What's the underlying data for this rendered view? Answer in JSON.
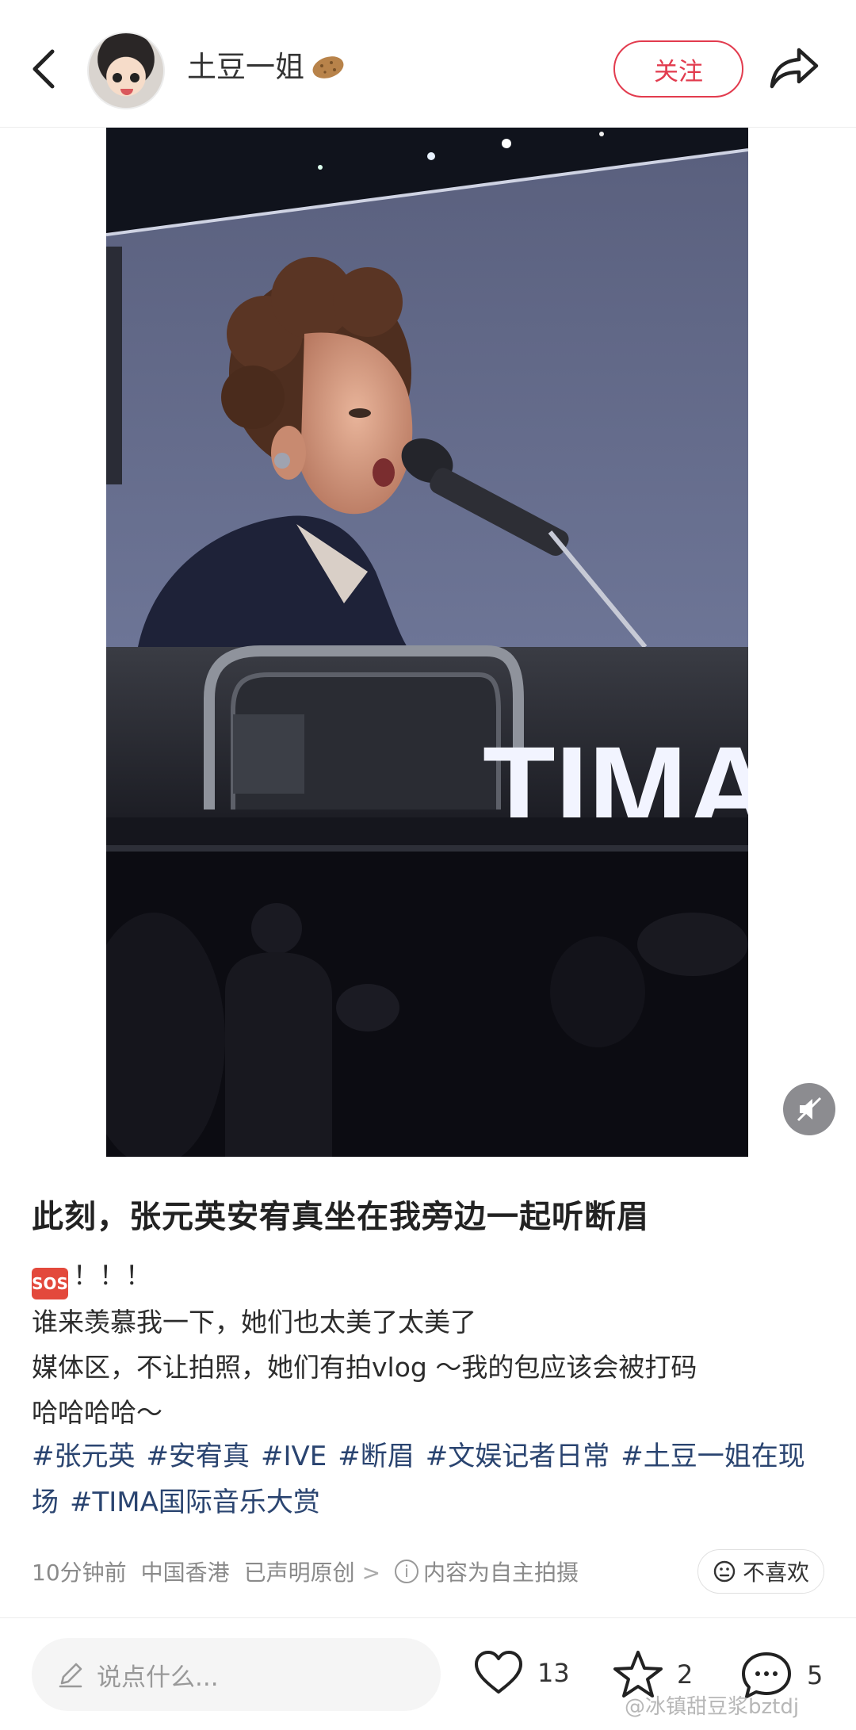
{
  "header": {
    "username": "土豆一姐",
    "follow_label": "关注"
  },
  "photo": {
    "screen_text": "TIMA"
  },
  "post": {
    "title": "此刻，张元英安宥真坐在我旁边一起听断眉",
    "sos_badge": "SOS",
    "line1_rest": "！！！",
    "line2": "谁来羡慕我一下，她们也太美了太美了",
    "line3": "媒体区，不让拍照，她们有拍vlog ～我的包应该会被打码",
    "line4": "哈哈哈哈～",
    "tags": [
      "#张元英",
      "#安宥真",
      "#IVE",
      "#断眉",
      "#文娱记者日常",
      "#土豆一姐在现场",
      "#TIMA国际音乐大赏"
    ]
  },
  "meta": {
    "time": "10分钟前",
    "location": "中国香港",
    "original": "已声明原创",
    "chevron": ">",
    "info_text": "内容为自主拍摄",
    "dislike_label": "不喜欢"
  },
  "bottom_bar": {
    "comment_placeholder": "说点什么...",
    "likes": "13",
    "favorites": "2",
    "comments": "5"
  },
  "watermark": "@冰镇甜豆浆bztdj",
  "colors": {
    "accent_red": "#e23b4e",
    "tag_blue": "#2a4470",
    "meta_gray": "#8a8a8a"
  }
}
